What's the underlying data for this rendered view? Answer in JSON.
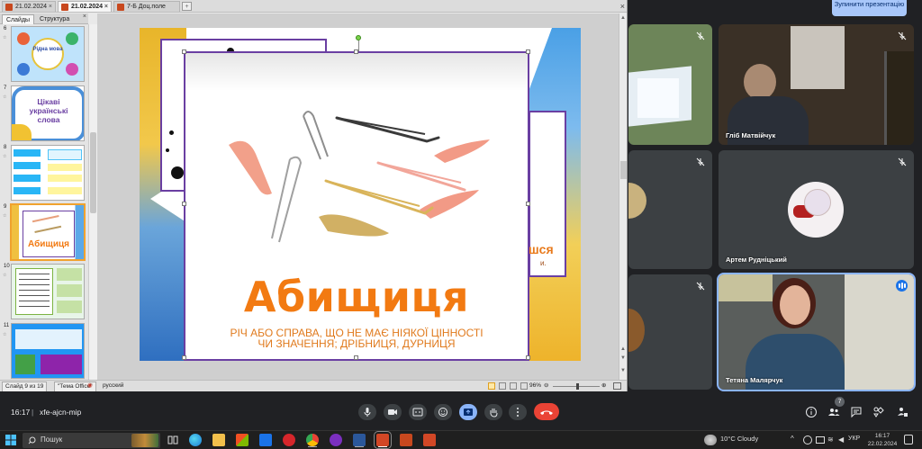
{
  "ppt": {
    "tabs": [
      "21.02.2024",
      "21.02.2024",
      "7-Б Доц.поле"
    ],
    "pane_tabs": [
      "Слайды",
      "Структура"
    ],
    "thumbnails": [
      {
        "num": "6",
        "text": "Рідна мова"
      },
      {
        "num": "7",
        "text": "Цікаві українські слова"
      },
      {
        "num": "8",
        "text": ""
      },
      {
        "num": "9",
        "text": "Абищиця"
      },
      {
        "num": "10",
        "text": ""
      },
      {
        "num": "11",
        "text": ""
      }
    ],
    "slide": {
      "title": "Абищиця",
      "definition_line1": "РІЧ АБО СПРАВА, ЩО НЕ МАЄ НІЯКОЇ ЦІННОСТІ",
      "definition_line2": "ЧИ ЗНАЧЕННЯ; ДРІБНИЦЯ, ДУРНИЦЯ",
      "back_word": "шся",
      "back_word2": "и."
    },
    "status": {
      "slide_counter": "Слайд 9 из 19",
      "theme": "\"Тема Office\"",
      "language": "русский",
      "zoom": "96%"
    }
  },
  "meet": {
    "stop_presenting": "Зупинити презентацію",
    "participants": [
      {
        "name": ""
      },
      {
        "name": "Гліб Матвійчук"
      },
      {
        "name": ""
      },
      {
        "name": "Артем Рудніцький"
      },
      {
        "name": ""
      },
      {
        "name": "Тетяна Малярчук"
      }
    ],
    "clock": "16:17",
    "meeting_code": "xfe-ajcn-mip",
    "people_count": "7",
    "colors": {
      "end_call": "#ea4335",
      "accent": "#8ab4f8"
    }
  },
  "taskbar": {
    "search_placeholder": "Пошук",
    "weather": "10°C  Cloudy",
    "lang": "УКР",
    "time": "16:17",
    "date": "22.02.2024"
  }
}
